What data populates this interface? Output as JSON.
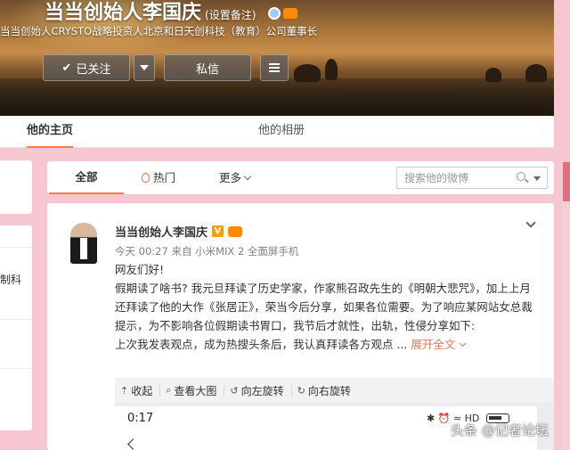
{
  "profile": {
    "name": "当当创始人李国庆",
    "name_note": "(设置备注)",
    "description": "当当创始人CRYSTO战略投资人北京和日天创科技（教育）公司董事长",
    "follow_label": "已关注",
    "message_label": "私信"
  },
  "tabs": {
    "home": "他的主页",
    "album": "他的相册"
  },
  "left_card": {
    "text": "制科"
  },
  "feed_tabs": {
    "all": "全部",
    "hot": "热门",
    "more": "更多",
    "search_placeholder": "搜索他的微博"
  },
  "post": {
    "author": "当当创始人李国庆",
    "vip_badge": "V",
    "meta": "今天 00:27 来自 小米MIX 2 全面屏手机",
    "lines": [
      "网友们好!",
      "假期读了啥书? 我元旦拜读了历史学家，作家熊召政先生的《明朝大悲咒》，加上上月还拜读了他的大作《张居正》，荣当今后分享，如果各位需要。为了响应某网站女总裁提示，为不影响各位假期读书胃口，我节后才就性，出轨，性侵分享如下:",
      "上次我发表观点，成为热搜头条后，我认真拜读各方观点 ..."
    ],
    "expand_label": "展开全文",
    "toolbar": {
      "collapse": "收起",
      "view_large": "查看大图",
      "rotate_left": "向左旋转",
      "rotate_right": "向右旋转"
    },
    "embed": {
      "time": "0:17",
      "status": "✱ ⏰ ≈ HD"
    }
  },
  "watermark": "头条 @记者论坛",
  "colors": {
    "accent": "#fa7d3c",
    "page_bg": "#f6c7d0",
    "expand_link": "#eb7350"
  }
}
